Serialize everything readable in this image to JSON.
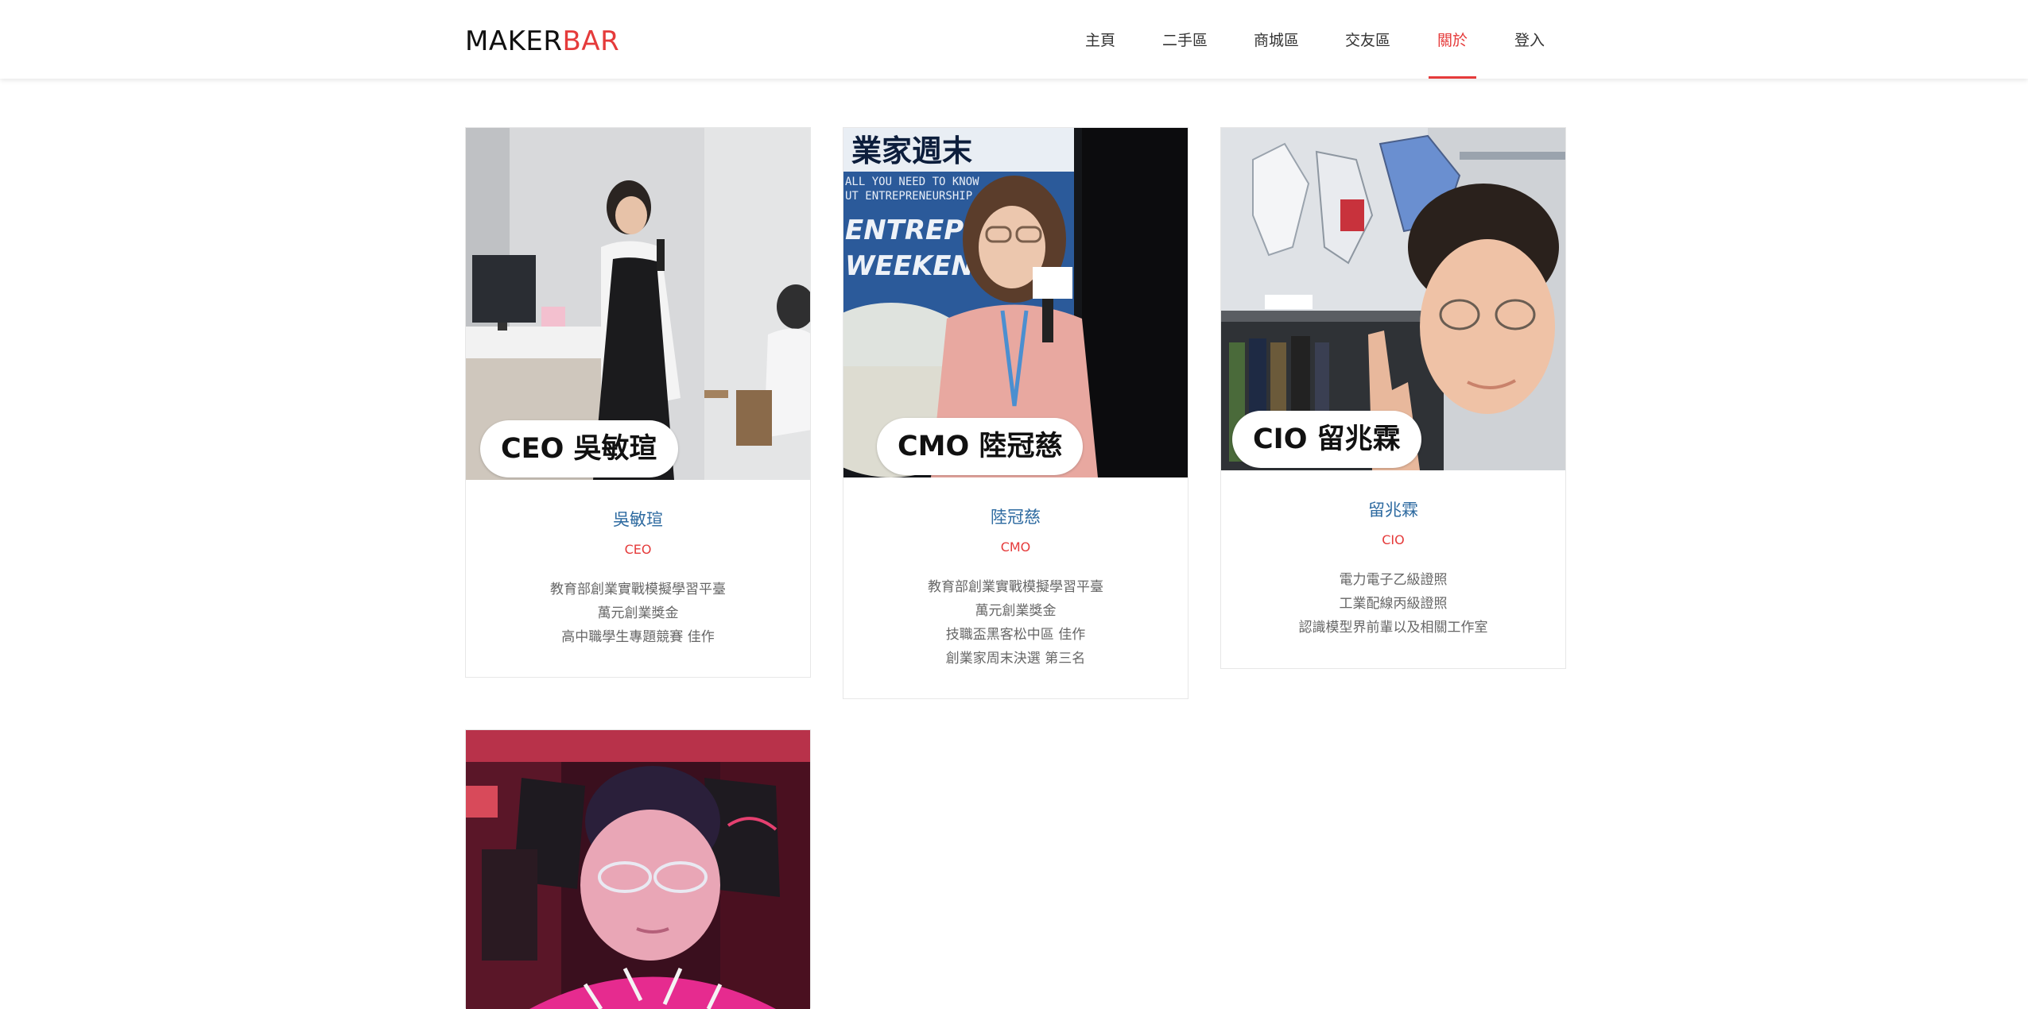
{
  "header": {
    "logo_part1": "MAKER",
    "logo_part2": "BAR",
    "nav": [
      {
        "label": "主頁"
      },
      {
        "label": "二手區"
      },
      {
        "label": "商城區"
      },
      {
        "label": "交友區"
      },
      {
        "label": "關於"
      },
      {
        "label": "登入"
      }
    ],
    "active_nav": "關於"
  },
  "colors": {
    "accent": "#e53b3b",
    "name": "#2d6aa0"
  },
  "team": [
    {
      "caption": "CEO 吳敏瑄",
      "name": "吳敏瑄",
      "role": "CEO",
      "achievements": [
        "教育部創業實戰模擬學習平臺",
        "萬元創業獎金",
        "高中職學生專題競賽 佳作"
      ]
    },
    {
      "caption": "CMO 陸冠慈",
      "name": "陸冠慈",
      "role": "CMO",
      "backdrop": [
        "業家週末",
        "ALL YOU NEED TO KNOW",
        "UT ENTREPRENEURSHIP",
        "ENTREPREN",
        "WEEKEND"
      ],
      "achievements": [
        "教育部創業實戰模擬學習平臺",
        "萬元創業獎金",
        "技職盃黑客松中區 佳作",
        "創業家周末決選 第三名"
      ]
    },
    {
      "caption": "CIO 留兆霖",
      "name": "留兆霖",
      "role": "CIO",
      "achievements": [
        "電力電子乙級證照",
        "工業配線丙級證照",
        "認識模型界前輩以及相關工作室"
      ]
    },
    {
      "caption": "",
      "name": "",
      "role": "",
      "achievements": []
    }
  ]
}
